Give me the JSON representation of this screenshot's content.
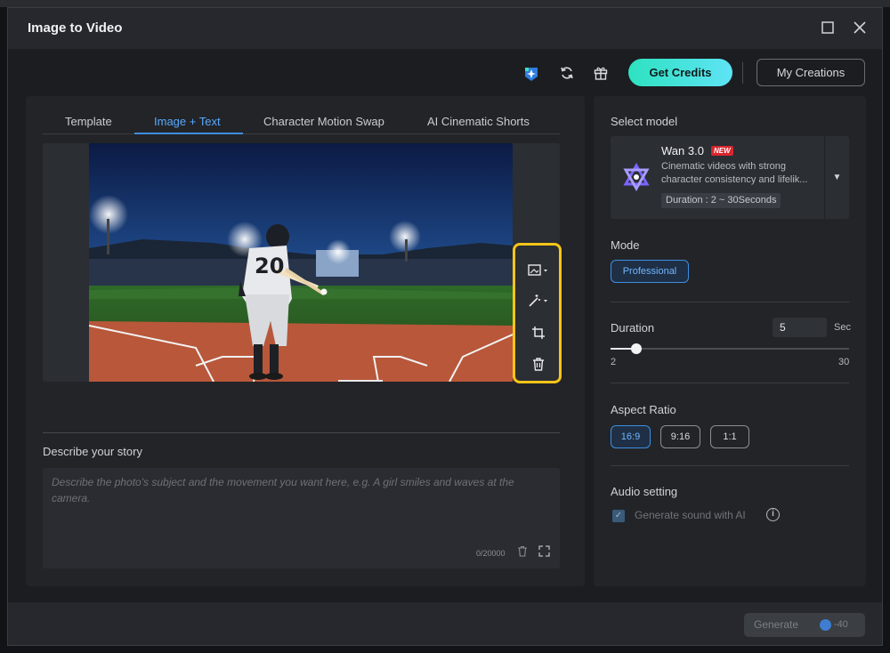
{
  "window": {
    "title": "Image to Video",
    "maximize_icon": "maximize-icon",
    "close_icon": "close-icon"
  },
  "topbar": {
    "icons": [
      "ai-badge-icon",
      "refresh-icon",
      "gift-icon"
    ],
    "get_credits_label": "Get Credits",
    "my_creations_label": "My Creations"
  },
  "tabs": [
    {
      "label": "Template",
      "active": false
    },
    {
      "label": "Image + Text",
      "active": true
    },
    {
      "label": "Character Motion Swap",
      "active": false
    },
    {
      "label": "AI Cinematic Shorts",
      "active": false
    }
  ],
  "image_tools": [
    "replace-image-icon",
    "magic-wand-icon",
    "crop-icon",
    "trash-icon"
  ],
  "photo": {
    "jersey_number": "20"
  },
  "story": {
    "label": "Describe your story",
    "placeholder": "Describe the photo's subject and the movement you want here, e.g. A girl smiles and waves at the camera.",
    "counter": "0/20000"
  },
  "model": {
    "section_label": "Select model",
    "name": "Wan 3.0",
    "badge": "NEW",
    "description": "Cinematic videos with strong character consistency and lifelik...",
    "duration_chip": "Duration : 2 ~ 30Seconds"
  },
  "mode": {
    "label": "Mode",
    "selected": "Professional"
  },
  "duration": {
    "label": "Duration",
    "value": "5",
    "unit": "Sec",
    "min": "2",
    "max": "30",
    "slider_fraction": 0.107
  },
  "aspect_ratio": {
    "label": "Aspect Ratio",
    "options": [
      {
        "label": "16:9",
        "active": true
      },
      {
        "label": "9:16",
        "active": false
      },
      {
        "label": "1:1",
        "active": false
      }
    ]
  },
  "audio": {
    "label": "Audio setting",
    "checkbox_label": "Generate sound with AI",
    "checked": true
  },
  "footer": {
    "generate_label": "Generate",
    "cost": "-40"
  },
  "colors": {
    "accent": "#3e8fe0",
    "credits_gradient_start": "#2de2c0",
    "credits_gradient_end": "#5fe3f5",
    "highlight": "#f5c518"
  }
}
